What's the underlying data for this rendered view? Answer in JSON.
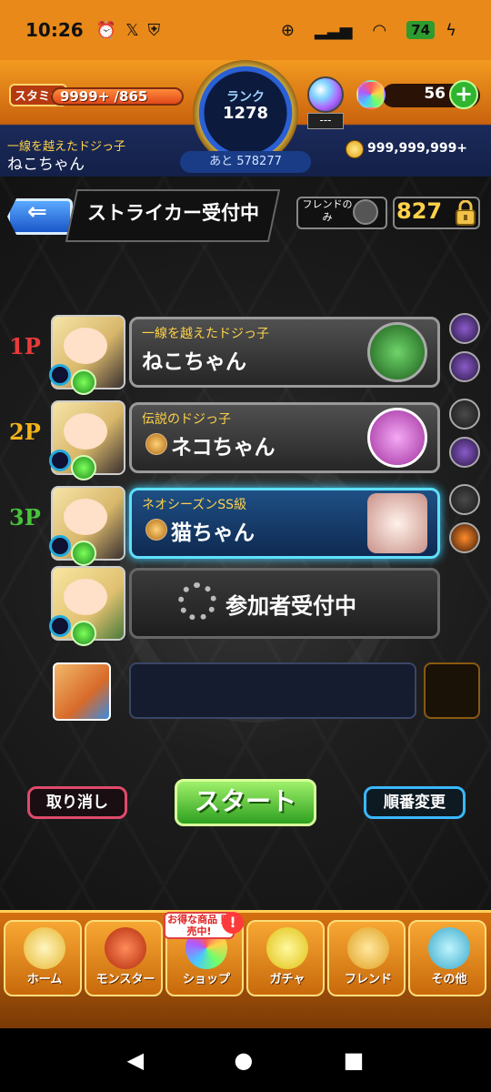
{
  "status_bar": {
    "time": "10:26",
    "battery": "74"
  },
  "header": {
    "stamina_label": "スタミナ",
    "stamina_value": "9999+ /865",
    "rank_label": "ランク",
    "rank_value": "1278",
    "rank_next": "あと 578277",
    "orb_sub": "---",
    "orb_count": "56",
    "player_title": "一線を越えたドジっ子",
    "player_name": "ねこちゃん",
    "gold": "999,999,999+"
  },
  "toolbar": {
    "title": "ストライカー受付中",
    "friend_only": "フレンドのみ",
    "room_code": "827"
  },
  "players": [
    {
      "num": "1P",
      "color": "#e83a3a",
      "title": "一線を越えたドジっ子",
      "name": "ねこちゃん",
      "active": false,
      "pic": "#2a8a3a"
    },
    {
      "num": "2P",
      "color": "#f2b21a",
      "title": "伝説のドジっ子",
      "name": "ネコちゃん",
      "active": false,
      "pic": "#c64ac6"
    },
    {
      "num": "3P",
      "color": "#46c23a",
      "title": "ネオシーズンSS級",
      "name": "猫ちゃん",
      "active": true,
      "pic": "#f0d0c0"
    }
  ],
  "waiting": {
    "text": "参加者受付中"
  },
  "buttons": {
    "cancel": "取り消し",
    "start": "スタート",
    "order": "順番変更"
  },
  "nav": {
    "promo": "お得な商品 販売中!",
    "items": [
      {
        "label": "ホーム",
        "icon": "home-icon"
      },
      {
        "label": "モンスター",
        "icon": "monster-icon"
      },
      {
        "label": "ショップ",
        "icon": "shop-icon"
      },
      {
        "label": "ガチャ",
        "icon": "gacha-icon"
      },
      {
        "label": "フレンド",
        "icon": "friend-icon"
      },
      {
        "label": "その他",
        "icon": "other-icon"
      }
    ]
  }
}
